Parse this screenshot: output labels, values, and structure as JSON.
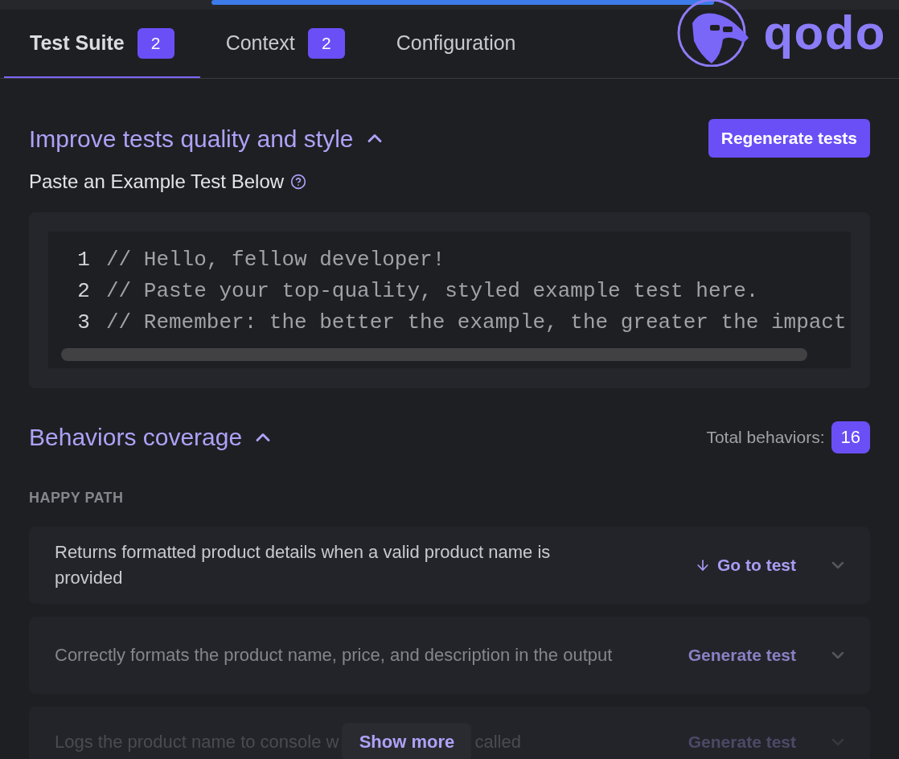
{
  "tabs": [
    {
      "label": "Test Suite",
      "badge": "2",
      "selected": true
    },
    {
      "label": "Context",
      "badge": "2",
      "selected": false
    },
    {
      "label": "Configuration",
      "selected": false
    }
  ],
  "logo": {
    "text": "qodo"
  },
  "style_section": {
    "title": "Improve tests quality and style",
    "expanded": true,
    "button": "Regenerate tests",
    "label": "Paste an Example Test Below",
    "code_lines": [
      {
        "number": "1",
        "text": "// Hello, fellow developer!"
      },
      {
        "number": "2",
        "text": "// Paste your top-quality, styled example test here."
      },
      {
        "number": "3",
        "text": "// Remember: the better the example, the greater the impact"
      }
    ]
  },
  "behaviors_section": {
    "title": "Behaviors coverage",
    "expanded": true,
    "total_label": "Total behaviors:",
    "total": "16",
    "group": "HAPPY PATH",
    "rows": [
      {
        "text": "Returns formatted product details when a valid product name is provided",
        "action": "Go to test",
        "kind": "go_to_test",
        "dimmed": false
      },
      {
        "text": "Correctly formats the product name, price, and description in the output",
        "action": "Generate test",
        "kind": "generate",
        "dimmed": true
      },
      {
        "text": "Logs the product name to console w",
        "text_after": "called",
        "action": "Generate test",
        "kind": "generate",
        "dimmed": true
      }
    ],
    "show_more": "Show more"
  }
}
